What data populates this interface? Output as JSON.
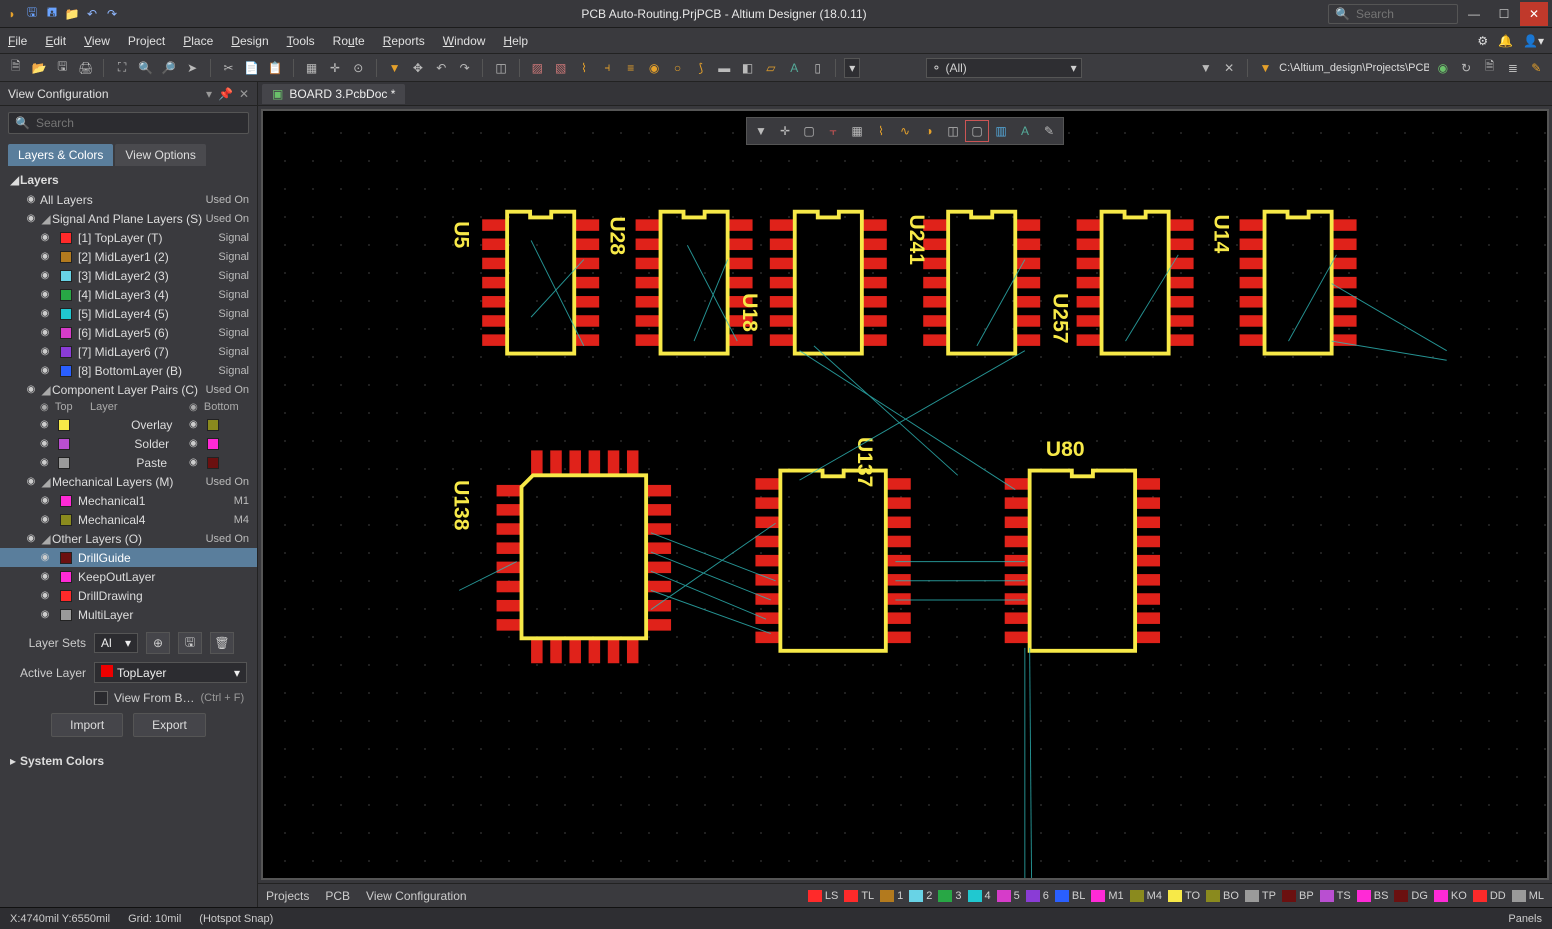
{
  "titlebar": {
    "title": "PCB Auto-Routing.PrjPCB - Altium Designer (18.0.11)",
    "search_ph": "Search"
  },
  "menu": {
    "file": "File",
    "edit": "Edit",
    "view": "View",
    "project": "Project",
    "place": "Place",
    "design": "Design",
    "tools": "Tools",
    "route": "Route",
    "reports": "Reports",
    "window": "Window",
    "help": "Help"
  },
  "toolbar": {
    "filter_all": "(All)",
    "path": "C:\\Altium_design\\Projects\\PCB Au…"
  },
  "panel": {
    "title": "View Configuration",
    "search_ph": "Search",
    "tab1": "Layers & Colors",
    "tab2": "View Options"
  },
  "tree": {
    "layers_hdr": "Layers",
    "all_layers": "All Layers",
    "used": "Used On",
    "sig_plane": "Signal And Plane Layers (S)",
    "sig": [
      {
        "n": "[1] TopLayer (T)",
        "m": "Signal",
        "c": "#ff2a2a"
      },
      {
        "n": "[2] MidLayer1 (2)",
        "m": "Signal",
        "c": "#b37a1e"
      },
      {
        "n": "[3] MidLayer2 (3)",
        "m": "Signal",
        "c": "#68d3e6"
      },
      {
        "n": "[4] MidLayer3 (4)",
        "m": "Signal",
        "c": "#28a745"
      },
      {
        "n": "[5] MidLayer4 (5)",
        "m": "Signal",
        "c": "#20c8d0"
      },
      {
        "n": "[6] MidLayer5 (6)",
        "m": "Signal",
        "c": "#d63cc9"
      },
      {
        "n": "[7] MidLayer6 (7)",
        "m": "Signal",
        "c": "#8a3cd6"
      },
      {
        "n": "[8] BottomLayer (B)",
        "m": "Signal",
        "c": "#2a5fff"
      }
    ],
    "comp_pairs": "Component Layer Pairs (C)",
    "ph_top": "Top",
    "ph_layer": "Layer",
    "ph_bot": "Bottom",
    "pairs": [
      {
        "l": "Overlay",
        "tc": "#f7e948",
        "bc": "#8a8a1e"
      },
      {
        "l": "Solder",
        "tc": "#b94fd1",
        "bc": "#ff2ad6"
      },
      {
        "l": "Paste",
        "tc": "#9a9a9a",
        "bc": "#6b1010"
      }
    ],
    "mech_hdr": "Mechanical Layers (M)",
    "mech": [
      {
        "n": "Mechanical1",
        "m": "M1",
        "c": "#ff2ad6"
      },
      {
        "n": "Mechanical4",
        "m": "M4",
        "c": "#8a8a1e"
      }
    ],
    "other_hdr": "Other Layers (O)",
    "other": [
      {
        "n": "DrillGuide",
        "c": "#6b1010",
        "sel": true
      },
      {
        "n": "KeepOutLayer",
        "c": "#ff2ad6"
      },
      {
        "n": "DrillDrawing",
        "c": "#ff2a2a"
      },
      {
        "n": "MultiLayer",
        "c": "#9a9a9a"
      }
    ]
  },
  "ctrls": {
    "layer_sets": "Layer Sets",
    "layer_sets_val": "Al",
    "active_layer": "Active Layer",
    "active_val": "TopLayer",
    "viewfrom": "View From B…",
    "viewfrom_sc": "(Ctrl + F)",
    "import": "Import",
    "export": "Export",
    "syscolors": "System Colors"
  },
  "tabbar": {
    "doc": "BOARD 3.PcbDoc *"
  },
  "bottomtabs": {
    "projects": "Projects",
    "pcb": "PCB",
    "viewconf": "View Configuration",
    "panels": "Panels"
  },
  "layerstrip": [
    {
      "t": "LS",
      "c": "#ff2a2a"
    },
    {
      "t": "TL",
      "c": "#ff2a2a"
    },
    {
      "t": "1",
      "c": "#b37a1e"
    },
    {
      "t": "2",
      "c": "#68d3e6"
    },
    {
      "t": "3",
      "c": "#28a745"
    },
    {
      "t": "4",
      "c": "#20c8d0"
    },
    {
      "t": "5",
      "c": "#d63cc9"
    },
    {
      "t": "6",
      "c": "#8a3cd6"
    },
    {
      "t": "BL",
      "c": "#2a5fff"
    },
    {
      "t": "M1",
      "c": "#ff2ad6"
    },
    {
      "t": "M4",
      "c": "#8a8a1e"
    },
    {
      "t": "TO",
      "c": "#f7e948"
    },
    {
      "t": "BO",
      "c": "#8a8a1e"
    },
    {
      "t": "TP",
      "c": "#9a9a9a"
    },
    {
      "t": "BP",
      "c": "#6b1010"
    },
    {
      "t": "TS",
      "c": "#b94fd1"
    },
    {
      "t": "BS",
      "c": "#ff2ad6"
    },
    {
      "t": "DG",
      "c": "#6b1010"
    },
    {
      "t": "KO",
      "c": "#ff2ad6"
    },
    {
      "t": "DD",
      "c": "#ff2a2a"
    },
    {
      "t": "ML",
      "c": "#9a9a9a"
    }
  ],
  "status": {
    "coord": "X:4740mil Y:6550mil",
    "grid": "Grid: 10mil",
    "snap": "(Hotspot Snap)"
  },
  "pcb": {
    "designators": [
      "U5",
      "U28",
      "U18",
      "U241",
      "U257",
      "U14",
      "U138",
      "U137",
      "U80"
    ]
  }
}
